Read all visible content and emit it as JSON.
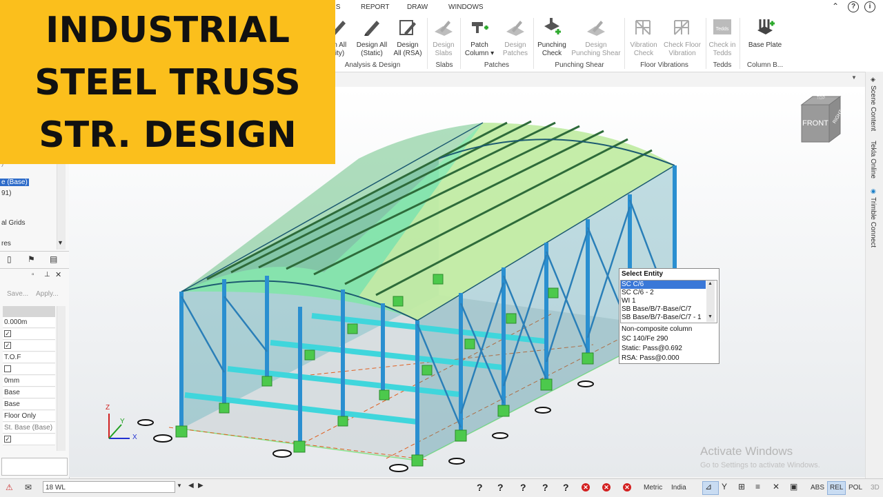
{
  "menu": {
    "items": [
      "IS",
      "REPORT",
      "DRAW",
      "WINDOWS"
    ]
  },
  "ribbon": {
    "buttons": [
      {
        "label1": "gn All",
        "label2": "vity)",
        "icon": "pencil-icon"
      },
      {
        "label1": "Design All",
        "label2": "(Static)",
        "icon": "pencil-icon"
      },
      {
        "label1": "Design",
        "label2": "All (RSA)",
        "icon": "design-rsa-icon"
      },
      {
        "label1": "Design",
        "label2": "Slabs",
        "icon": "slab-pencil-icon"
      },
      {
        "label1": "Patch",
        "label2": "Column ▾",
        "icon": "patch-column-icon"
      },
      {
        "label1": "Design",
        "label2": "Patches",
        "icon": "patch-pencil-icon"
      },
      {
        "label1": "Punching",
        "label2": "Check",
        "icon": "punching-check-icon"
      },
      {
        "label1": "Design",
        "label2": "Punching Shear",
        "icon": "punching-pencil-icon"
      },
      {
        "label1": "Vibration",
        "label2": "Check",
        "icon": "vibration-icon"
      },
      {
        "label1": "Check Floor",
        "label2": "Vibration",
        "icon": "floor-vibration-icon"
      },
      {
        "label1": "Check in",
        "label2": "Tedds",
        "icon": "tedds-icon"
      },
      {
        "label1": "Base Plate",
        "label2": "",
        "icon": "base-plate-icon"
      }
    ],
    "groups": [
      "Analysis & Design",
      "Slabs",
      "Patches",
      "Punching Shear",
      "Floor Vibrations",
      "Tedds",
      "Column B..."
    ]
  },
  "overlay": {
    "lines": [
      "INDUSTRIAL",
      "STEEL TRUSS",
      "STR. DESIGN"
    ]
  },
  "tree": {
    "items": [
      ")",
      "e (Base)",
      "91)",
      "al Grids",
      "res"
    ]
  },
  "props": {
    "save_label": "Save...",
    "apply_label": "Apply...",
    "rows": [
      "0.000m",
      "☑",
      "☑",
      "T.O.F",
      "☐",
      "0mm",
      "Base",
      "Base",
      "Floor Only",
      "St. Base (Base)",
      "☑"
    ]
  },
  "view_cube": {
    "front": "FRONT",
    "right": "RIGHT",
    "top": "TOP"
  },
  "right_tabs": [
    "Scene Content",
    "Tekla Online",
    "Trimble Connect"
  ],
  "select_entity": {
    "title": "Select Entity",
    "items": [
      "SC C/6",
      "SC C/6 - 2",
      "WI 1",
      "SB Base/B/7-Base/C/7",
      "SB Base/B/7-Base/C/7 - 1"
    ],
    "info": [
      "Non-composite column",
      "SC 140/Fe 290",
      "Static: Pass@0.692",
      "RSA: Pass@0.000"
    ]
  },
  "axes": {
    "z": "Z",
    "y": "Y",
    "x": "X"
  },
  "status": {
    "level_value": "18 WL",
    "units": "Metric",
    "region": "India",
    "abs": "ABS",
    "rel": "REL",
    "pol": "POL",
    "mode_3d": "3D",
    "watermark_title": "Activate Windows",
    "watermark_sub": "Go to Settings to activate Windows."
  },
  "colors": {
    "overlay": "#fbbf1c",
    "roof": "#7fe0a0",
    "column": "#2a8fd0",
    "footing": "#4cc94c",
    "accent": "#3a78d8"
  }
}
